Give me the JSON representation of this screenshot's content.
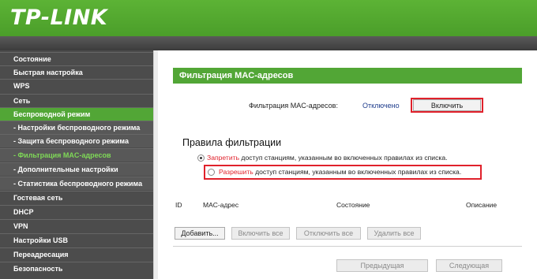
{
  "brand": {
    "logo": "TP-LINK"
  },
  "sidebar": {
    "items": [
      {
        "label": "Состояние"
      },
      {
        "label": "Быстрая настройка"
      },
      {
        "label": "WPS"
      },
      {
        "label": "Сеть"
      },
      {
        "label": "Беспроводной режим"
      },
      {
        "label": "- Настройки беспроводного режима"
      },
      {
        "label": "- Защита беспроводного режима"
      },
      {
        "label": "- Фильтрация MAC-адресов"
      },
      {
        "label": "- Дополнительные настройки"
      },
      {
        "label": "- Статистика беспроводного режима"
      },
      {
        "label": "Гостевая сеть"
      },
      {
        "label": "DHCP"
      },
      {
        "label": "VPN"
      },
      {
        "label": "Настройки USB"
      },
      {
        "label": "Переадресация"
      },
      {
        "label": "Безопасность"
      }
    ]
  },
  "main": {
    "title": "Фильтрация MAC-адресов",
    "filter_label": "Фильтрация MAC-адресов:",
    "filter_status": "Отключено",
    "enable_button": "Включить",
    "rules_heading": "Правила фильтрации",
    "rule_deny_keyword": "Запретить",
    "rule_deny_text": " доступ станциям, указанным во включенных правилах из списка.",
    "rule_allow_keyword": "Разрешить",
    "rule_allow_text": " доступ станциям, указанным во включенных правилах из списка.",
    "rule_selected": "deny",
    "columns": [
      "ID",
      "MAC-адрес",
      "Состояние",
      "Описание"
    ],
    "add_button": "Добавить...",
    "enable_all_button": "Включить все",
    "disable_all_button": "Отключить все",
    "delete_all_button": "Удалить все",
    "prev_button": "Предыдущая",
    "next_button": "Следующая"
  },
  "colors": {
    "brand_green": "#52a636",
    "highlight_red": "#e0212b",
    "status_blue": "#1e3c8c"
  }
}
